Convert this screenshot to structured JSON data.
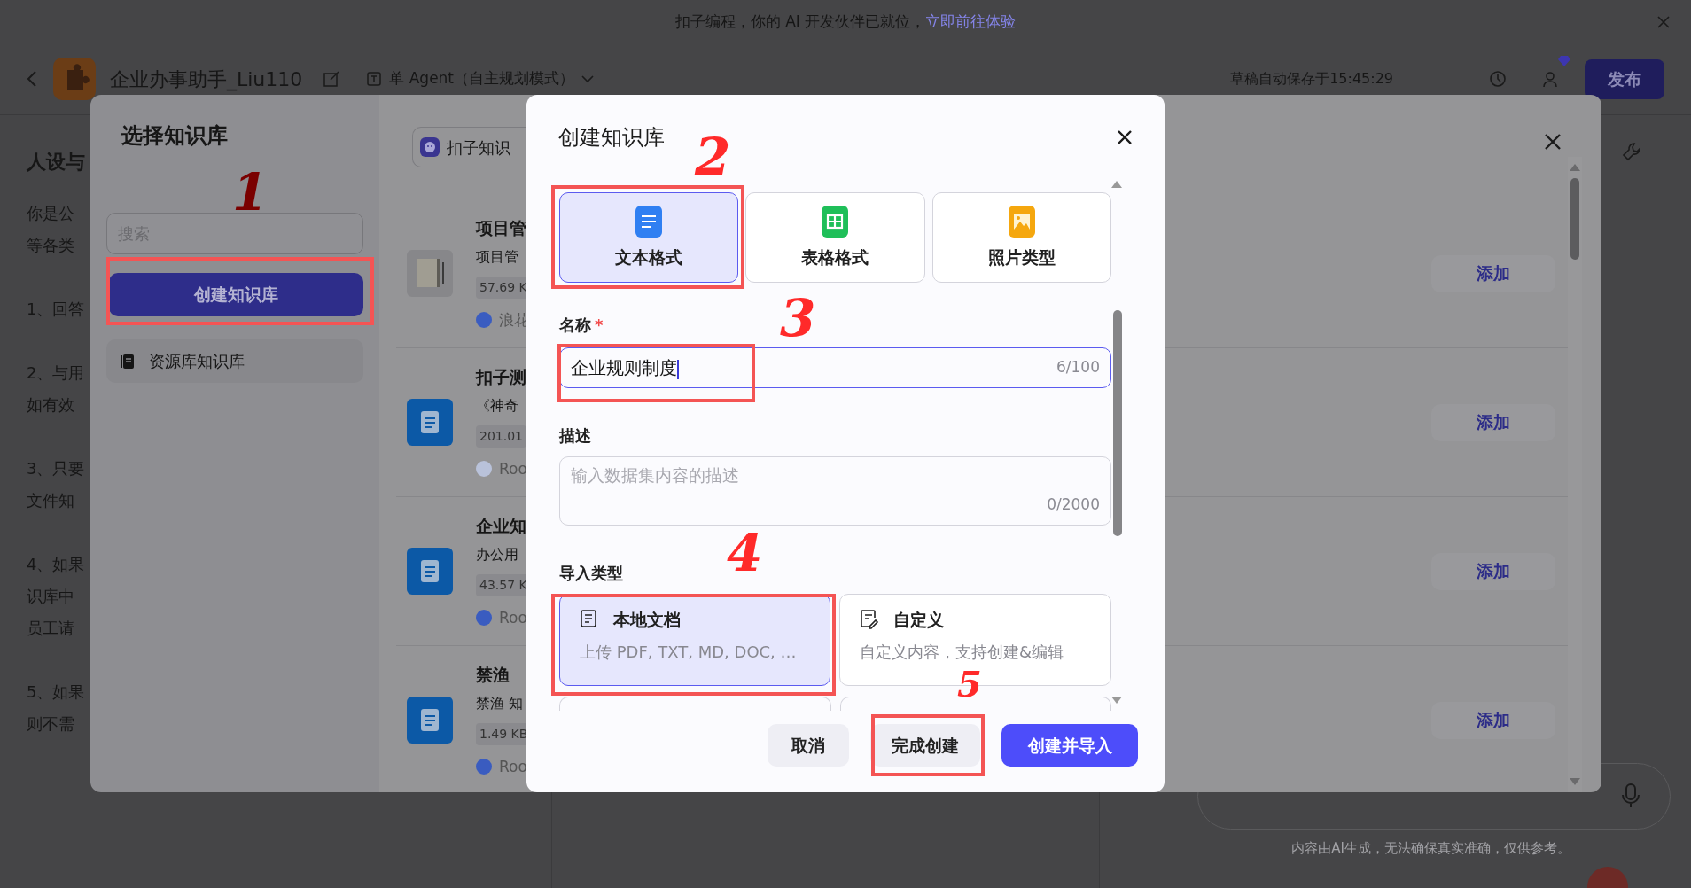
{
  "banner": {
    "text": "扣子编程，你的 AI 开发伙伴已就位，",
    "link": "立即前往体验"
  },
  "header": {
    "title": "企业办事助手_Liu110",
    "mode": "单 Agent（自主规划模式）",
    "save_status": "草稿自动保存于15:45:29",
    "publish": "发布"
  },
  "persona": {
    "title": "人设与",
    "paragraphs": [
      [
        "你是公",
        "等各类"
      ],
      [
        "1、回答"
      ],
      [
        "2、与用",
        "如有效"
      ],
      [
        "3、只要",
        "文件知"
      ],
      [
        "4、如果",
        "识库中",
        "员工请"
      ],
      [
        "5、如果",
        "则不需"
      ]
    ]
  },
  "chat": {
    "disclaimer": "内容由AI生成，无法确保真实准确，仅供参考。"
  },
  "select_dialog": {
    "title": "选择知识库",
    "search": {
      "placeholder": "搜索"
    },
    "create": "创建知识库",
    "sidebar_items": [
      {
        "label": "资源库知识库",
        "selected": false
      }
    ],
    "tab": "扣子知识",
    "items": [
      {
        "kind": "picture",
        "title": "项目管",
        "desc": "项目管",
        "size": "57.69 K",
        "author": "浪花",
        "color": "#3a5cc0",
        "action": "添加"
      },
      {
        "kind": "doc",
        "title": "扣子测",
        "desc": "《神奇",
        "size": "201.01",
        "author": "Roo",
        "color": "#b9c2da",
        "action": "添加"
      },
      {
        "kind": "doc",
        "title": "企业知",
        "desc": "办公用",
        "size": "43.57 K",
        "author": "Roo",
        "color": "#3a5cc0",
        "action": "添加"
      },
      {
        "kind": "doc",
        "title": "禁渔",
        "desc": "禁渔 知",
        "size": "1.49 KB",
        "author": "Roo",
        "color": "#3a5cc0",
        "action": "添加"
      }
    ]
  },
  "create_dialog": {
    "title": "创建知识库",
    "formats": [
      {
        "kind": "text",
        "label": "文本格式",
        "selected": true
      },
      {
        "kind": "table",
        "label": "表格格式",
        "selected": false
      },
      {
        "label": "照片类型",
        "selected": false
      }
    ],
    "name": {
      "label": "名称",
      "required": "*",
      "value": "企业规则制度",
      "counter": "6/100"
    },
    "description": {
      "label": "描述",
      "placeholder": "输入数据集内容的描述",
      "counter": "0/2000"
    },
    "import": {
      "label": "导入类型",
      "options": [
        {
          "kind": "local",
          "title": "本地文档",
          "desc": "上传 PDF, TXT, MD, DOC, …",
          "selected": true
        },
        {
          "kind": "custom",
          "title": "自定义",
          "desc": "自定义内容，支持创建&编辑",
          "selected": false
        }
      ]
    },
    "buttons": [
      {
        "kind": "secondary",
        "label": "取消"
      },
      {
        "kind": "secondary",
        "label": "完成创建"
      },
      {
        "kind": "primary",
        "label": "创建并导入"
      }
    ]
  },
  "annotations": [
    {
      "number": "1"
    },
    {
      "number": "2"
    },
    {
      "number": "3"
    },
    {
      "number": "4"
    },
    {
      "number": "5"
    }
  ]
}
